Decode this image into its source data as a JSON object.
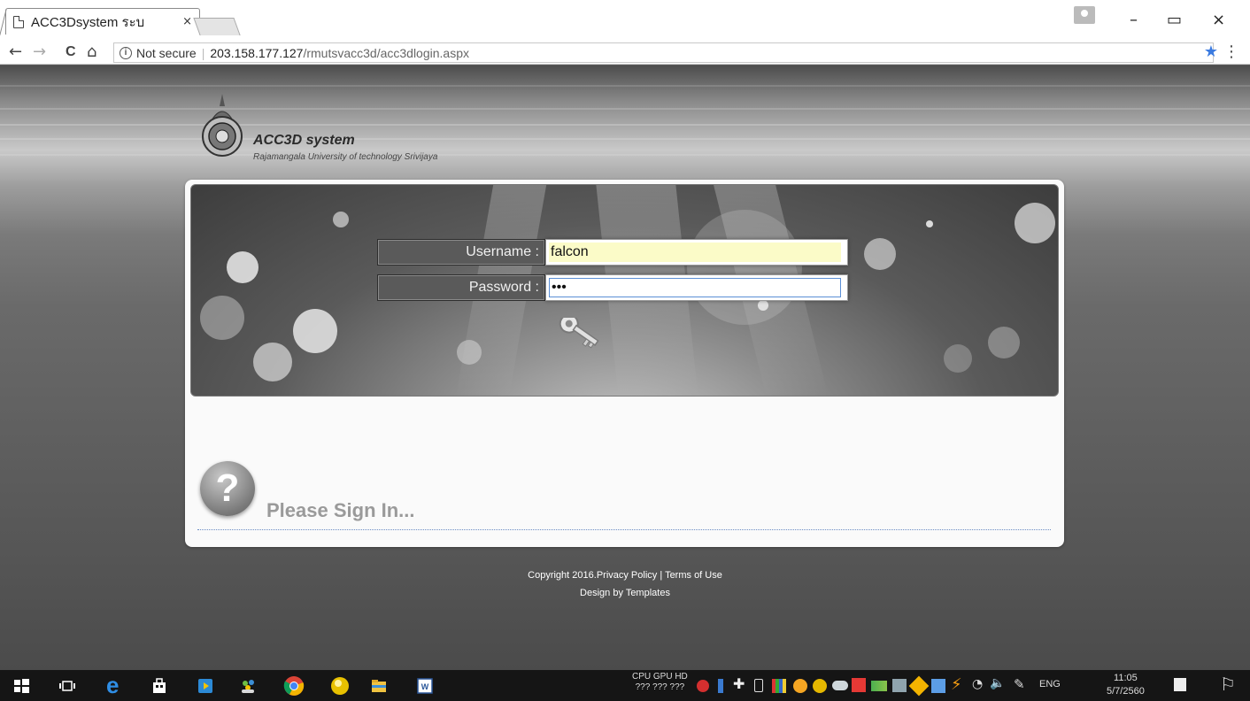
{
  "browser": {
    "tab_title": "ACC3Dsystem ระบ",
    "tab_close": "×",
    "security_label": "Not secure",
    "url_host": "203.158.177.127",
    "url_path": "/rmutsvacc3d/acc3dlogin.aspx",
    "window_controls": {
      "minimize": "–",
      "restore": "▭",
      "close": "×"
    },
    "nav": {
      "back": "←",
      "forward": "→",
      "reload": "C",
      "home": "⌂"
    }
  },
  "site": {
    "title": "ACC3D system",
    "subtitle": "Rajamangala University of technology Srivijaya"
  },
  "login": {
    "username_label": "Username :",
    "username_value": "falcon",
    "password_label": "Password :",
    "password_value": "•••"
  },
  "prompt": {
    "help_glyph": "?",
    "text": "Please Sign In..."
  },
  "footer": {
    "copyright": "Copyright 2016.",
    "privacy": "Privacy Policy",
    "divider": " | ",
    "terms": "Terms of Use",
    "design": "Design by Templates"
  },
  "taskbar": {
    "hw_labels": "CPU GPU HD",
    "hw_values": "??? ??? ???",
    "language": "ENG",
    "time": "11:05",
    "date": "5/7/2560"
  },
  "colors": {
    "banner_dark": "#3d3d3d",
    "label_bg": "#5a5a5a",
    "username_fill": "#fbfbc8",
    "focus_border": "#5b8fd6",
    "taskbar_bg": "#151515"
  }
}
